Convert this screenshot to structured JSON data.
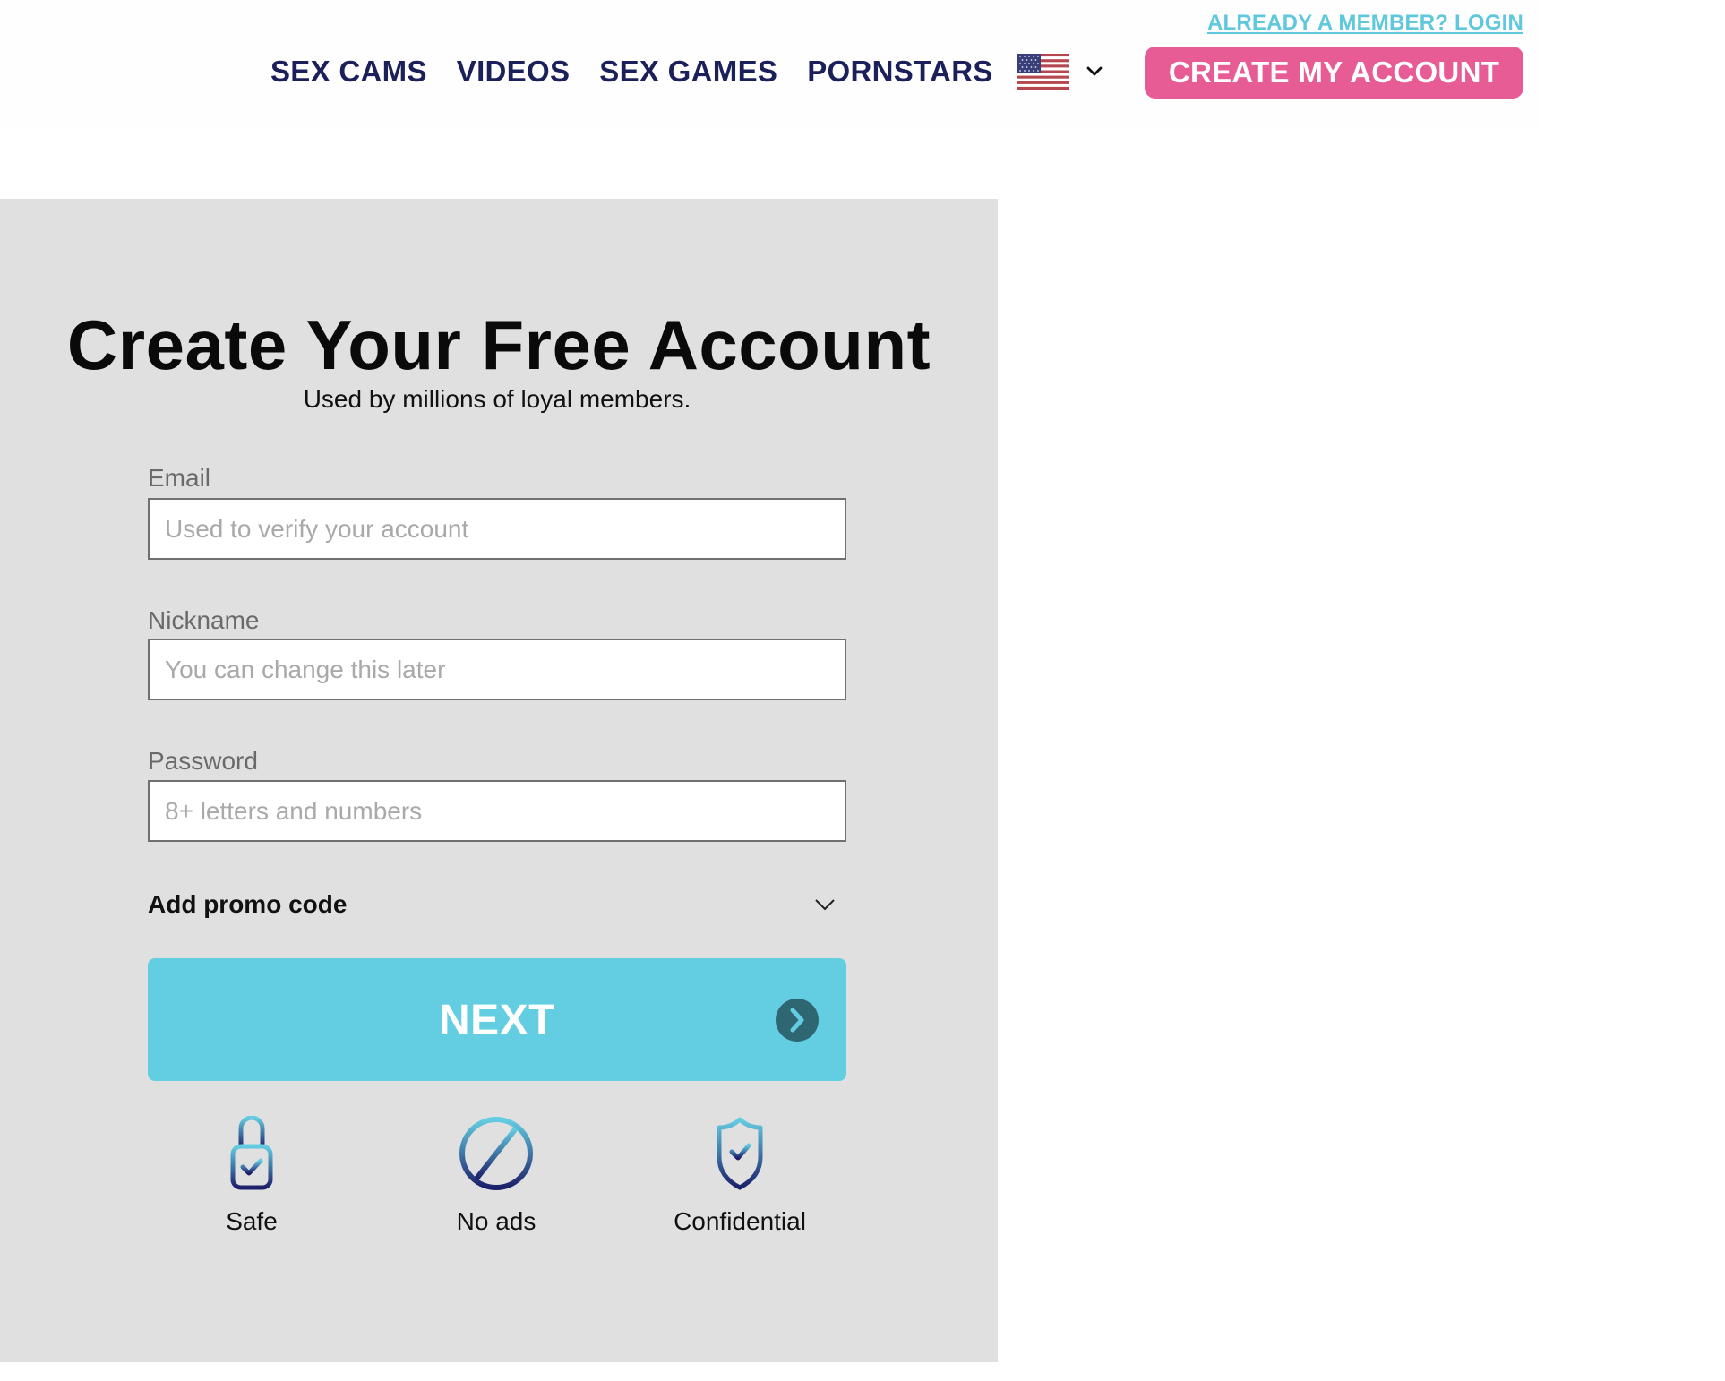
{
  "header": {
    "login_link": "ALREADY A MEMBER? LOGIN",
    "nav": [
      {
        "label": "SEX CAMS"
      },
      {
        "label": "VIDEOS"
      },
      {
        "label": "SEX GAMES"
      },
      {
        "label": "PORNSTARS"
      }
    ],
    "language": {
      "icon": "us-flag-icon",
      "dropdown_icon": "chevron-down-icon"
    },
    "create_account_button": "CREATE MY ACCOUNT"
  },
  "form": {
    "title": "Create Your Free Account",
    "subtitle": "Used by millions of loyal members.",
    "fields": [
      {
        "label": "Email",
        "placeholder": "Used to verify your account",
        "value": ""
      },
      {
        "label": "Nickname",
        "placeholder": "You can change this later",
        "value": ""
      },
      {
        "label": "Password",
        "placeholder": "8+ letters and numbers",
        "value": ""
      }
    ],
    "promo_label": "Add promo code",
    "next_button": "NEXT",
    "features": [
      {
        "icon": "lock-check-icon",
        "label": "Safe"
      },
      {
        "icon": "no-ads-icon",
        "label": "No ads"
      },
      {
        "icon": "shield-check-icon",
        "label": "Confidential"
      }
    ]
  },
  "colors": {
    "nav_text": "#1b1f5a",
    "login_link": "#5fc8dc",
    "create_button": "#e85c96",
    "next_button": "#63cde2",
    "panel_bg": "#e0e0e0"
  }
}
